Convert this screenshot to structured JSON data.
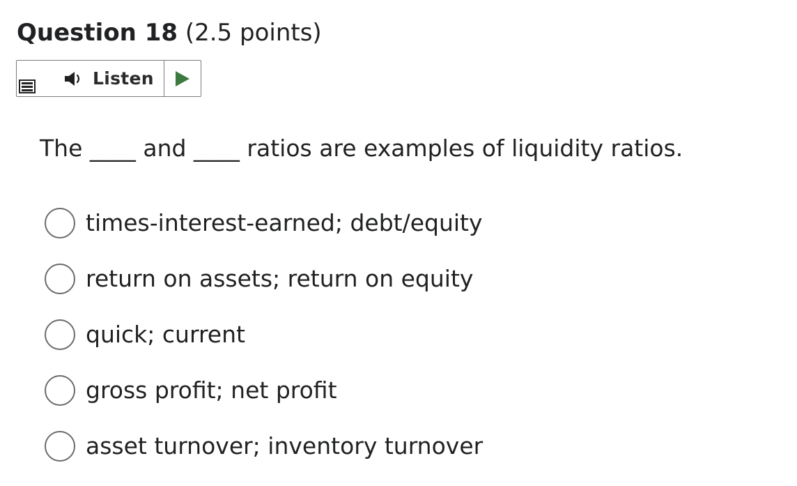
{
  "question": {
    "title": "Question 18",
    "points": "(2.5 points)",
    "text": "The ____ and ____ ratios are examples of liquidity ratios."
  },
  "listen": {
    "label": "Listen",
    "menu_icon": "menu-icon",
    "speaker_icon": "speaker-icon",
    "play_icon": "play-icon",
    "play_color": "#3d7a3f"
  },
  "options": [
    {
      "label": "times-interest-earned; debt/equity"
    },
    {
      "label": "return on assets; return on equity"
    },
    {
      "label": "quick; current"
    },
    {
      "label": "gross profit; net profit"
    },
    {
      "label": "asset turnover; inventory turnover"
    }
  ]
}
